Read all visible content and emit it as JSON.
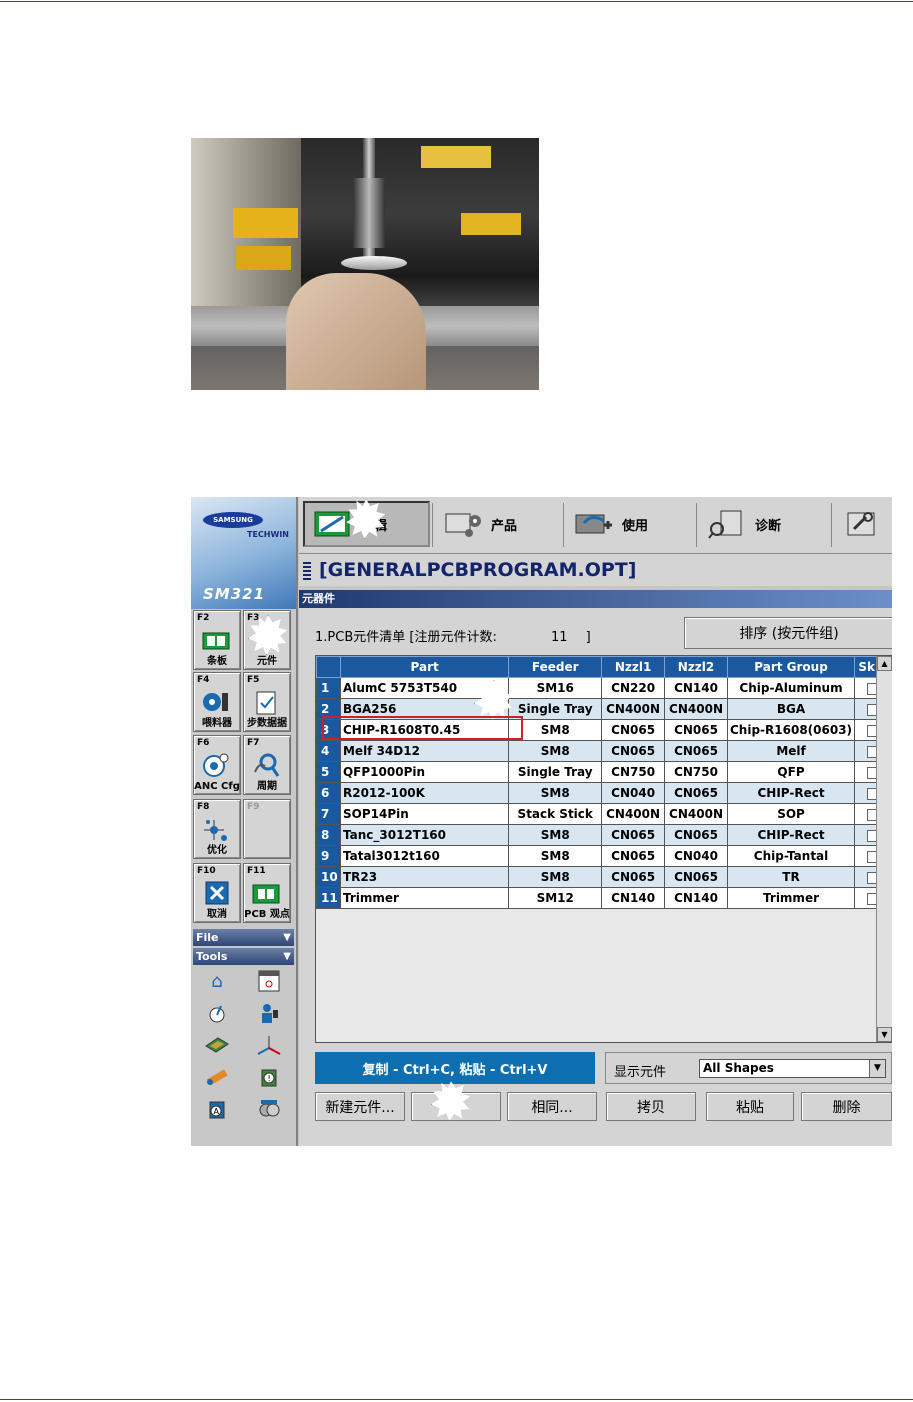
{
  "toolbar": {
    "items": [
      {
        "label": "编辑",
        "icon": "edit-icon"
      },
      {
        "label": "产品",
        "icon": "product-icon"
      },
      {
        "label": "使用",
        "icon": "utility-icon"
      },
      {
        "label": "诊断",
        "icon": "diagnosis-icon"
      },
      {
        "label": "",
        "icon": "tools-icon"
      }
    ]
  },
  "brand": {
    "maker": "SAMSUNG",
    "sub": "TECHWIN",
    "model": "SM321"
  },
  "title": "[GENERALPCBPROGRAM.OPT]",
  "section": "元器件",
  "count": {
    "label": "1.PCB元件清单 [注册元件计数:",
    "value": "11",
    "close": "]"
  },
  "sort_button": "排序 (按元件组)",
  "fkeys": [
    {
      "key": "F2",
      "label": "条板"
    },
    {
      "key": "F3",
      "label": "元件"
    },
    {
      "key": "F4",
      "label": "喂料器"
    },
    {
      "key": "F5",
      "label": "步数据据"
    },
    {
      "key": "F6",
      "label": "ANC Cfg"
    },
    {
      "key": "F7",
      "label": "周期"
    },
    {
      "key": "F8",
      "label": "优化"
    },
    {
      "key": "F9",
      "label": ""
    },
    {
      "key": "F10",
      "label": "取消"
    },
    {
      "key": "F11",
      "label": "PCB 观点"
    }
  ],
  "menus": {
    "file": "File",
    "tools": "Tools"
  },
  "table": {
    "headers": [
      "Part",
      "Feeder",
      "Nzzl1",
      "Nzzl2",
      "Part Group",
      "Skip"
    ],
    "rows": [
      {
        "n": "1",
        "part": "AlumC 5753T540",
        "feeder": "SM16",
        "n1": "CN220",
        "n2": "CN140",
        "group": "Chip-Aluminum"
      },
      {
        "n": "2",
        "part": "BGA256",
        "feeder": "Single Tray",
        "n1": "CN400N",
        "n2": "CN400N",
        "group": "BGA"
      },
      {
        "n": "3",
        "part": "CHIP-R1608T0.45",
        "feeder": "SM8",
        "n1": "CN065",
        "n2": "CN065",
        "group": "Chip-R1608(0603)"
      },
      {
        "n": "4",
        "part": "Melf 34D12",
        "feeder": "SM8",
        "n1": "CN065",
        "n2": "CN065",
        "group": "Melf"
      },
      {
        "n": "5",
        "part": "QFP1000Pin",
        "feeder": "Single Tray",
        "n1": "CN750",
        "n2": "CN750",
        "group": "QFP"
      },
      {
        "n": "6",
        "part": "R2012-100K",
        "feeder": "SM8",
        "n1": "CN040",
        "n2": "CN065",
        "group": "CHIP-Rect"
      },
      {
        "n": "7",
        "part": "SOP14Pin",
        "feeder": "Stack Stick",
        "n1": "CN400N",
        "n2": "CN400N",
        "group": "SOP"
      },
      {
        "n": "8",
        "part": "Tanc_3012T160",
        "feeder": "SM8",
        "n1": "CN065",
        "n2": "CN065",
        "group": "CHIP-Rect"
      },
      {
        "n": "9",
        "part": "Tatal3012t160",
        "feeder": "SM8",
        "n1": "CN065",
        "n2": "CN040",
        "group": "Chip-Tantal"
      },
      {
        "n": "10",
        "part": "TR23",
        "feeder": "SM8",
        "n1": "CN065",
        "n2": "CN065",
        "group": "TR"
      },
      {
        "n": "11",
        "part": "Trimmer",
        "feeder": "SM12",
        "n1": "CN140",
        "n2": "CN140",
        "group": "Trimmer"
      }
    ]
  },
  "copy_bar": "复制 - Ctrl+C, 粘贴 - Ctrl+V",
  "show": {
    "label": "显示元件",
    "selected": "All Shapes"
  },
  "buttons": {
    "new": "新建元件...",
    "edit": ".",
    "same": "相同...",
    "copy": "拷贝",
    "paste": "粘贴",
    "delete": "删除"
  }
}
